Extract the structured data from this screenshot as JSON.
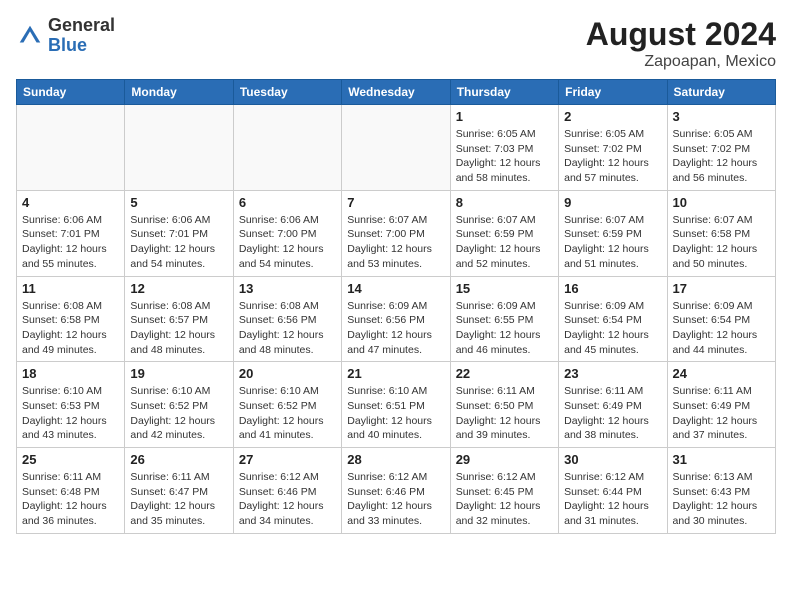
{
  "header": {
    "logo_line1": "General",
    "logo_line2": "Blue",
    "title": "August 2024",
    "subtitle": "Zapoapan, Mexico"
  },
  "weekdays": [
    "Sunday",
    "Monday",
    "Tuesday",
    "Wednesday",
    "Thursday",
    "Friday",
    "Saturday"
  ],
  "weeks": [
    [
      {
        "day": "",
        "info": ""
      },
      {
        "day": "",
        "info": ""
      },
      {
        "day": "",
        "info": ""
      },
      {
        "day": "",
        "info": ""
      },
      {
        "day": "1",
        "info": "Sunrise: 6:05 AM\nSunset: 7:03 PM\nDaylight: 12 hours\nand 58 minutes."
      },
      {
        "day": "2",
        "info": "Sunrise: 6:05 AM\nSunset: 7:02 PM\nDaylight: 12 hours\nand 57 minutes."
      },
      {
        "day": "3",
        "info": "Sunrise: 6:05 AM\nSunset: 7:02 PM\nDaylight: 12 hours\nand 56 minutes."
      }
    ],
    [
      {
        "day": "4",
        "info": "Sunrise: 6:06 AM\nSunset: 7:01 PM\nDaylight: 12 hours\nand 55 minutes."
      },
      {
        "day": "5",
        "info": "Sunrise: 6:06 AM\nSunset: 7:01 PM\nDaylight: 12 hours\nand 54 minutes."
      },
      {
        "day": "6",
        "info": "Sunrise: 6:06 AM\nSunset: 7:00 PM\nDaylight: 12 hours\nand 54 minutes."
      },
      {
        "day": "7",
        "info": "Sunrise: 6:07 AM\nSunset: 7:00 PM\nDaylight: 12 hours\nand 53 minutes."
      },
      {
        "day": "8",
        "info": "Sunrise: 6:07 AM\nSunset: 6:59 PM\nDaylight: 12 hours\nand 52 minutes."
      },
      {
        "day": "9",
        "info": "Sunrise: 6:07 AM\nSunset: 6:59 PM\nDaylight: 12 hours\nand 51 minutes."
      },
      {
        "day": "10",
        "info": "Sunrise: 6:07 AM\nSunset: 6:58 PM\nDaylight: 12 hours\nand 50 minutes."
      }
    ],
    [
      {
        "day": "11",
        "info": "Sunrise: 6:08 AM\nSunset: 6:58 PM\nDaylight: 12 hours\nand 49 minutes."
      },
      {
        "day": "12",
        "info": "Sunrise: 6:08 AM\nSunset: 6:57 PM\nDaylight: 12 hours\nand 48 minutes."
      },
      {
        "day": "13",
        "info": "Sunrise: 6:08 AM\nSunset: 6:56 PM\nDaylight: 12 hours\nand 48 minutes."
      },
      {
        "day": "14",
        "info": "Sunrise: 6:09 AM\nSunset: 6:56 PM\nDaylight: 12 hours\nand 47 minutes."
      },
      {
        "day": "15",
        "info": "Sunrise: 6:09 AM\nSunset: 6:55 PM\nDaylight: 12 hours\nand 46 minutes."
      },
      {
        "day": "16",
        "info": "Sunrise: 6:09 AM\nSunset: 6:54 PM\nDaylight: 12 hours\nand 45 minutes."
      },
      {
        "day": "17",
        "info": "Sunrise: 6:09 AM\nSunset: 6:54 PM\nDaylight: 12 hours\nand 44 minutes."
      }
    ],
    [
      {
        "day": "18",
        "info": "Sunrise: 6:10 AM\nSunset: 6:53 PM\nDaylight: 12 hours\nand 43 minutes."
      },
      {
        "day": "19",
        "info": "Sunrise: 6:10 AM\nSunset: 6:52 PM\nDaylight: 12 hours\nand 42 minutes."
      },
      {
        "day": "20",
        "info": "Sunrise: 6:10 AM\nSunset: 6:52 PM\nDaylight: 12 hours\nand 41 minutes."
      },
      {
        "day": "21",
        "info": "Sunrise: 6:10 AM\nSunset: 6:51 PM\nDaylight: 12 hours\nand 40 minutes."
      },
      {
        "day": "22",
        "info": "Sunrise: 6:11 AM\nSunset: 6:50 PM\nDaylight: 12 hours\nand 39 minutes."
      },
      {
        "day": "23",
        "info": "Sunrise: 6:11 AM\nSunset: 6:49 PM\nDaylight: 12 hours\nand 38 minutes."
      },
      {
        "day": "24",
        "info": "Sunrise: 6:11 AM\nSunset: 6:49 PM\nDaylight: 12 hours\nand 37 minutes."
      }
    ],
    [
      {
        "day": "25",
        "info": "Sunrise: 6:11 AM\nSunset: 6:48 PM\nDaylight: 12 hours\nand 36 minutes."
      },
      {
        "day": "26",
        "info": "Sunrise: 6:11 AM\nSunset: 6:47 PM\nDaylight: 12 hours\nand 35 minutes."
      },
      {
        "day": "27",
        "info": "Sunrise: 6:12 AM\nSunset: 6:46 PM\nDaylight: 12 hours\nand 34 minutes."
      },
      {
        "day": "28",
        "info": "Sunrise: 6:12 AM\nSunset: 6:46 PM\nDaylight: 12 hours\nand 33 minutes."
      },
      {
        "day": "29",
        "info": "Sunrise: 6:12 AM\nSunset: 6:45 PM\nDaylight: 12 hours\nand 32 minutes."
      },
      {
        "day": "30",
        "info": "Sunrise: 6:12 AM\nSunset: 6:44 PM\nDaylight: 12 hours\nand 31 minutes."
      },
      {
        "day": "31",
        "info": "Sunrise: 6:13 AM\nSunset: 6:43 PM\nDaylight: 12 hours\nand 30 minutes."
      }
    ]
  ]
}
